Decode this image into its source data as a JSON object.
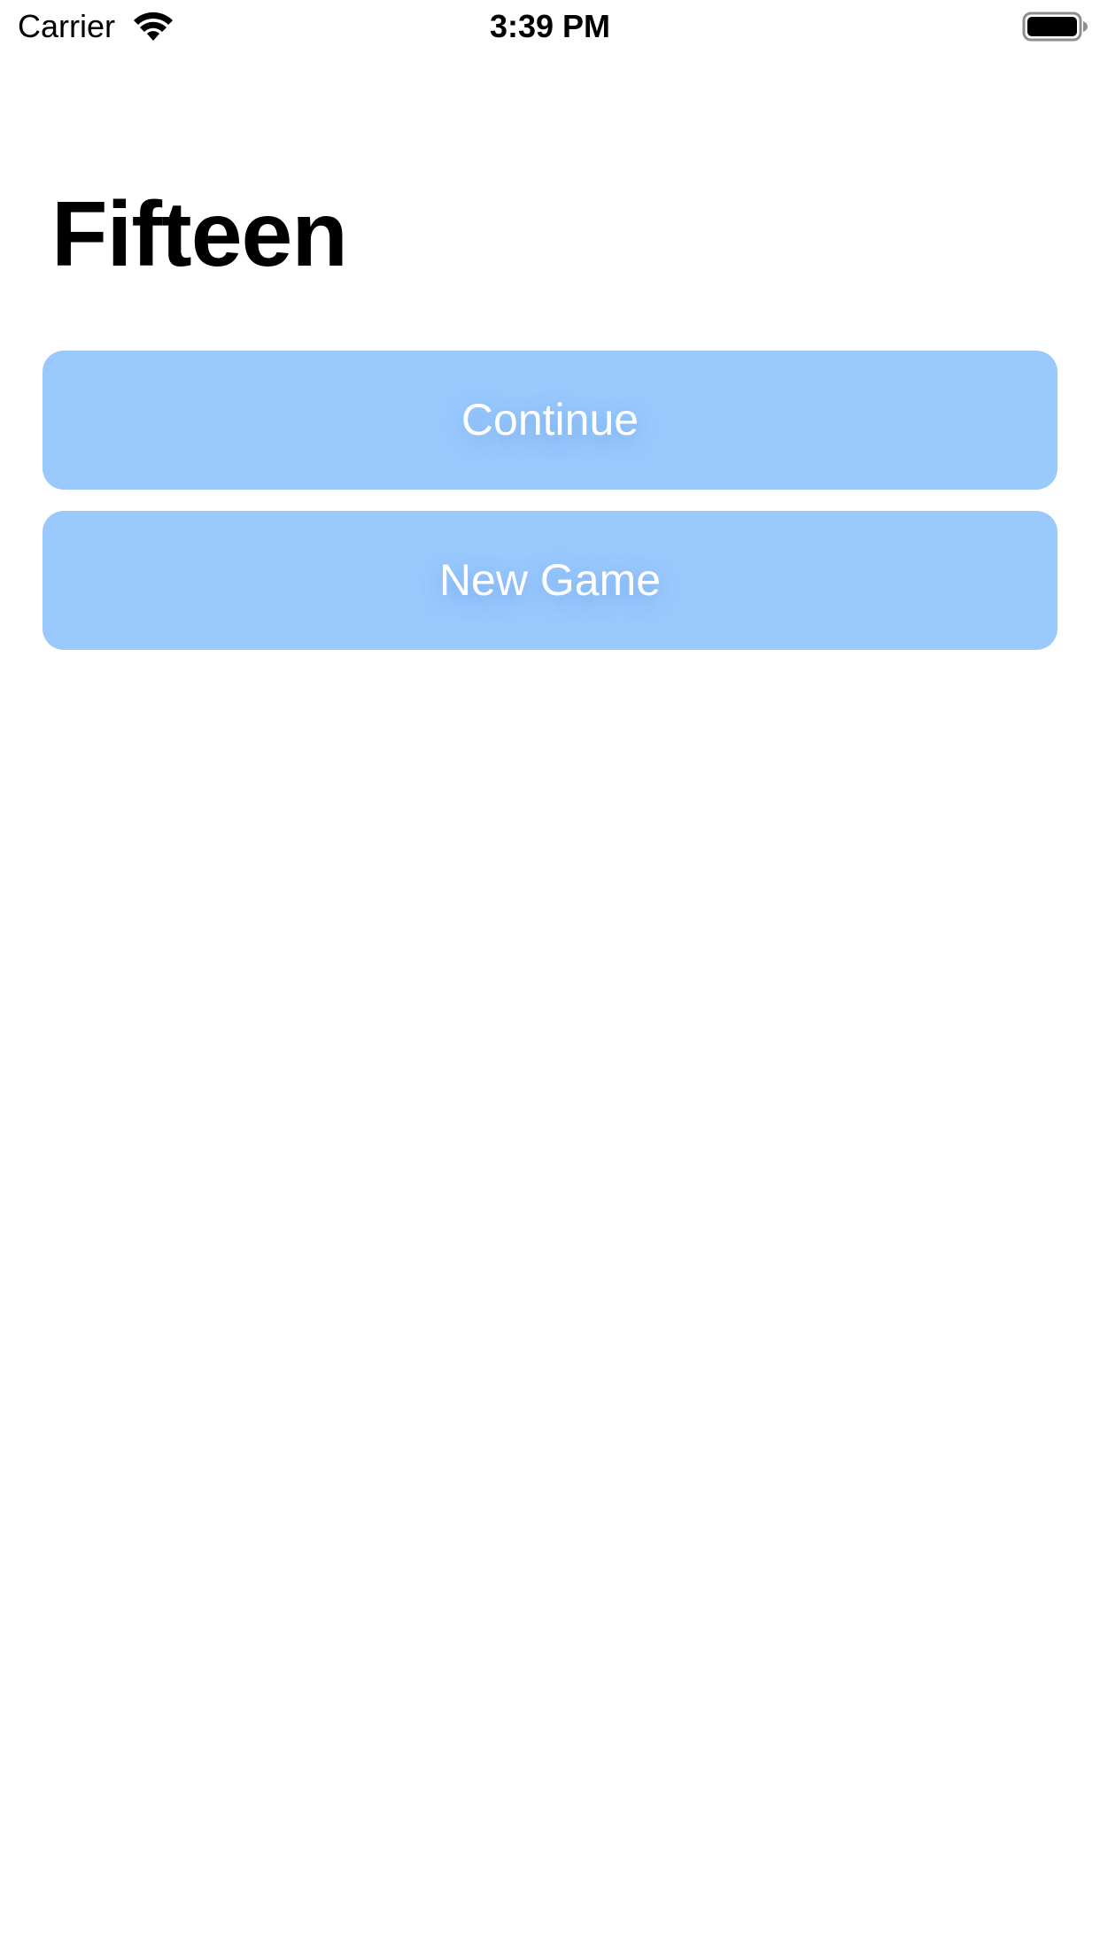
{
  "status_bar": {
    "carrier": "Carrier",
    "time": "3:39 PM",
    "wifi_icon": "wifi-icon",
    "battery_icon": "battery-full-icon"
  },
  "main": {
    "title": "Fifteen",
    "buttons": {
      "continue_label": "Continue",
      "new_game_label": "New Game"
    }
  },
  "colors": {
    "background": "#ffffff",
    "button_fill": "#99c9fd",
    "button_text": "#ffffff",
    "title_text": "#000000"
  }
}
